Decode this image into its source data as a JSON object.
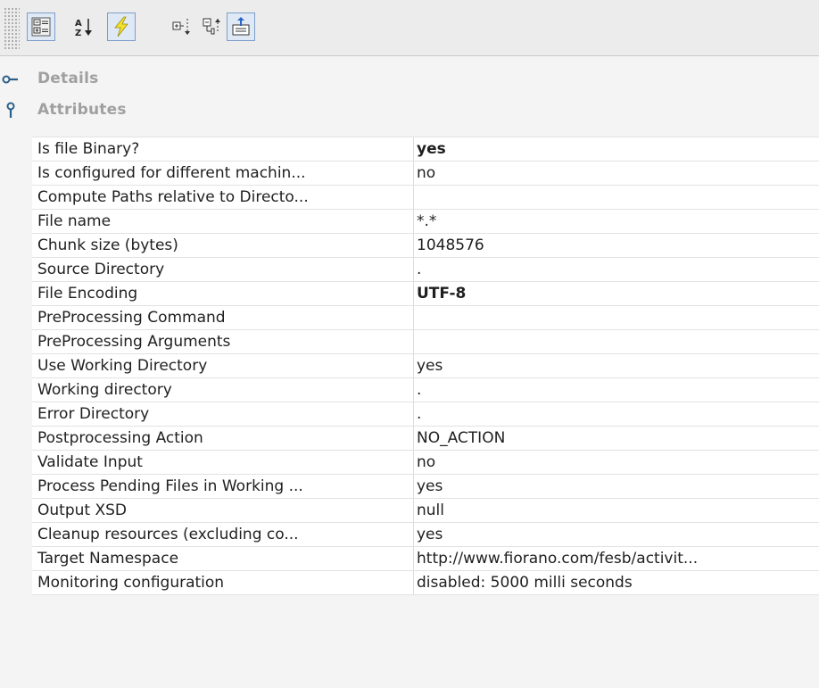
{
  "toolbar": {
    "buttons": [
      {
        "name": "categorized-view-icon",
        "selected": true
      },
      {
        "name": "sort-alphabetically-icon",
        "selected": false
      },
      {
        "name": "show-expert-properties-icon",
        "selected": true
      },
      {
        "name": "expand-all-icon",
        "selected": false
      },
      {
        "name": "collapse-all-icon",
        "selected": false
      },
      {
        "name": "import-export-icon",
        "selected": true
      }
    ]
  },
  "sections": {
    "details": {
      "label": "Details",
      "expanded": false
    },
    "attributes": {
      "label": "Attributes",
      "expanded": true
    }
  },
  "properties": [
    {
      "name": "Is file Binary?",
      "value": "yes",
      "bold": true
    },
    {
      "name": "Is configured for different machin...",
      "value": "no",
      "bold": false
    },
    {
      "name": "Compute Paths relative to Directo...",
      "value": "",
      "bold": false
    },
    {
      "name": "File name",
      "value": "*.*",
      "bold": false
    },
    {
      "name": "Chunk size (bytes)",
      "value": "1048576",
      "bold": false
    },
    {
      "name": "Source Directory",
      "value": ".",
      "bold": false
    },
    {
      "name": "File Encoding",
      "value": "UTF-8",
      "bold": true
    },
    {
      "name": "PreProcessing Command",
      "value": "",
      "bold": false
    },
    {
      "name": "PreProcessing Arguments",
      "value": "",
      "bold": false
    },
    {
      "name": "Use Working Directory",
      "value": "yes",
      "bold": false
    },
    {
      "name": "Working directory",
      "value": ".",
      "bold": false
    },
    {
      "name": "Error Directory",
      "value": ".",
      "bold": false
    },
    {
      "name": "Postprocessing Action",
      "value": "NO_ACTION",
      "bold": false
    },
    {
      "name": "Validate Input",
      "value": "no",
      "bold": false
    },
    {
      "name": "Process Pending Files in Working ...",
      "value": "yes",
      "bold": false
    },
    {
      "name": "Output XSD",
      "value": "null",
      "bold": false
    },
    {
      "name": "Cleanup resources (excluding co...",
      "value": "yes",
      "bold": false
    },
    {
      "name": "Target Namespace",
      "value": "http://www.fiorano.com/fesb/activit...",
      "bold": false
    },
    {
      "name": "Monitoring configuration",
      "value": "disabled: 5000 milli seconds",
      "bold": false
    }
  ]
}
